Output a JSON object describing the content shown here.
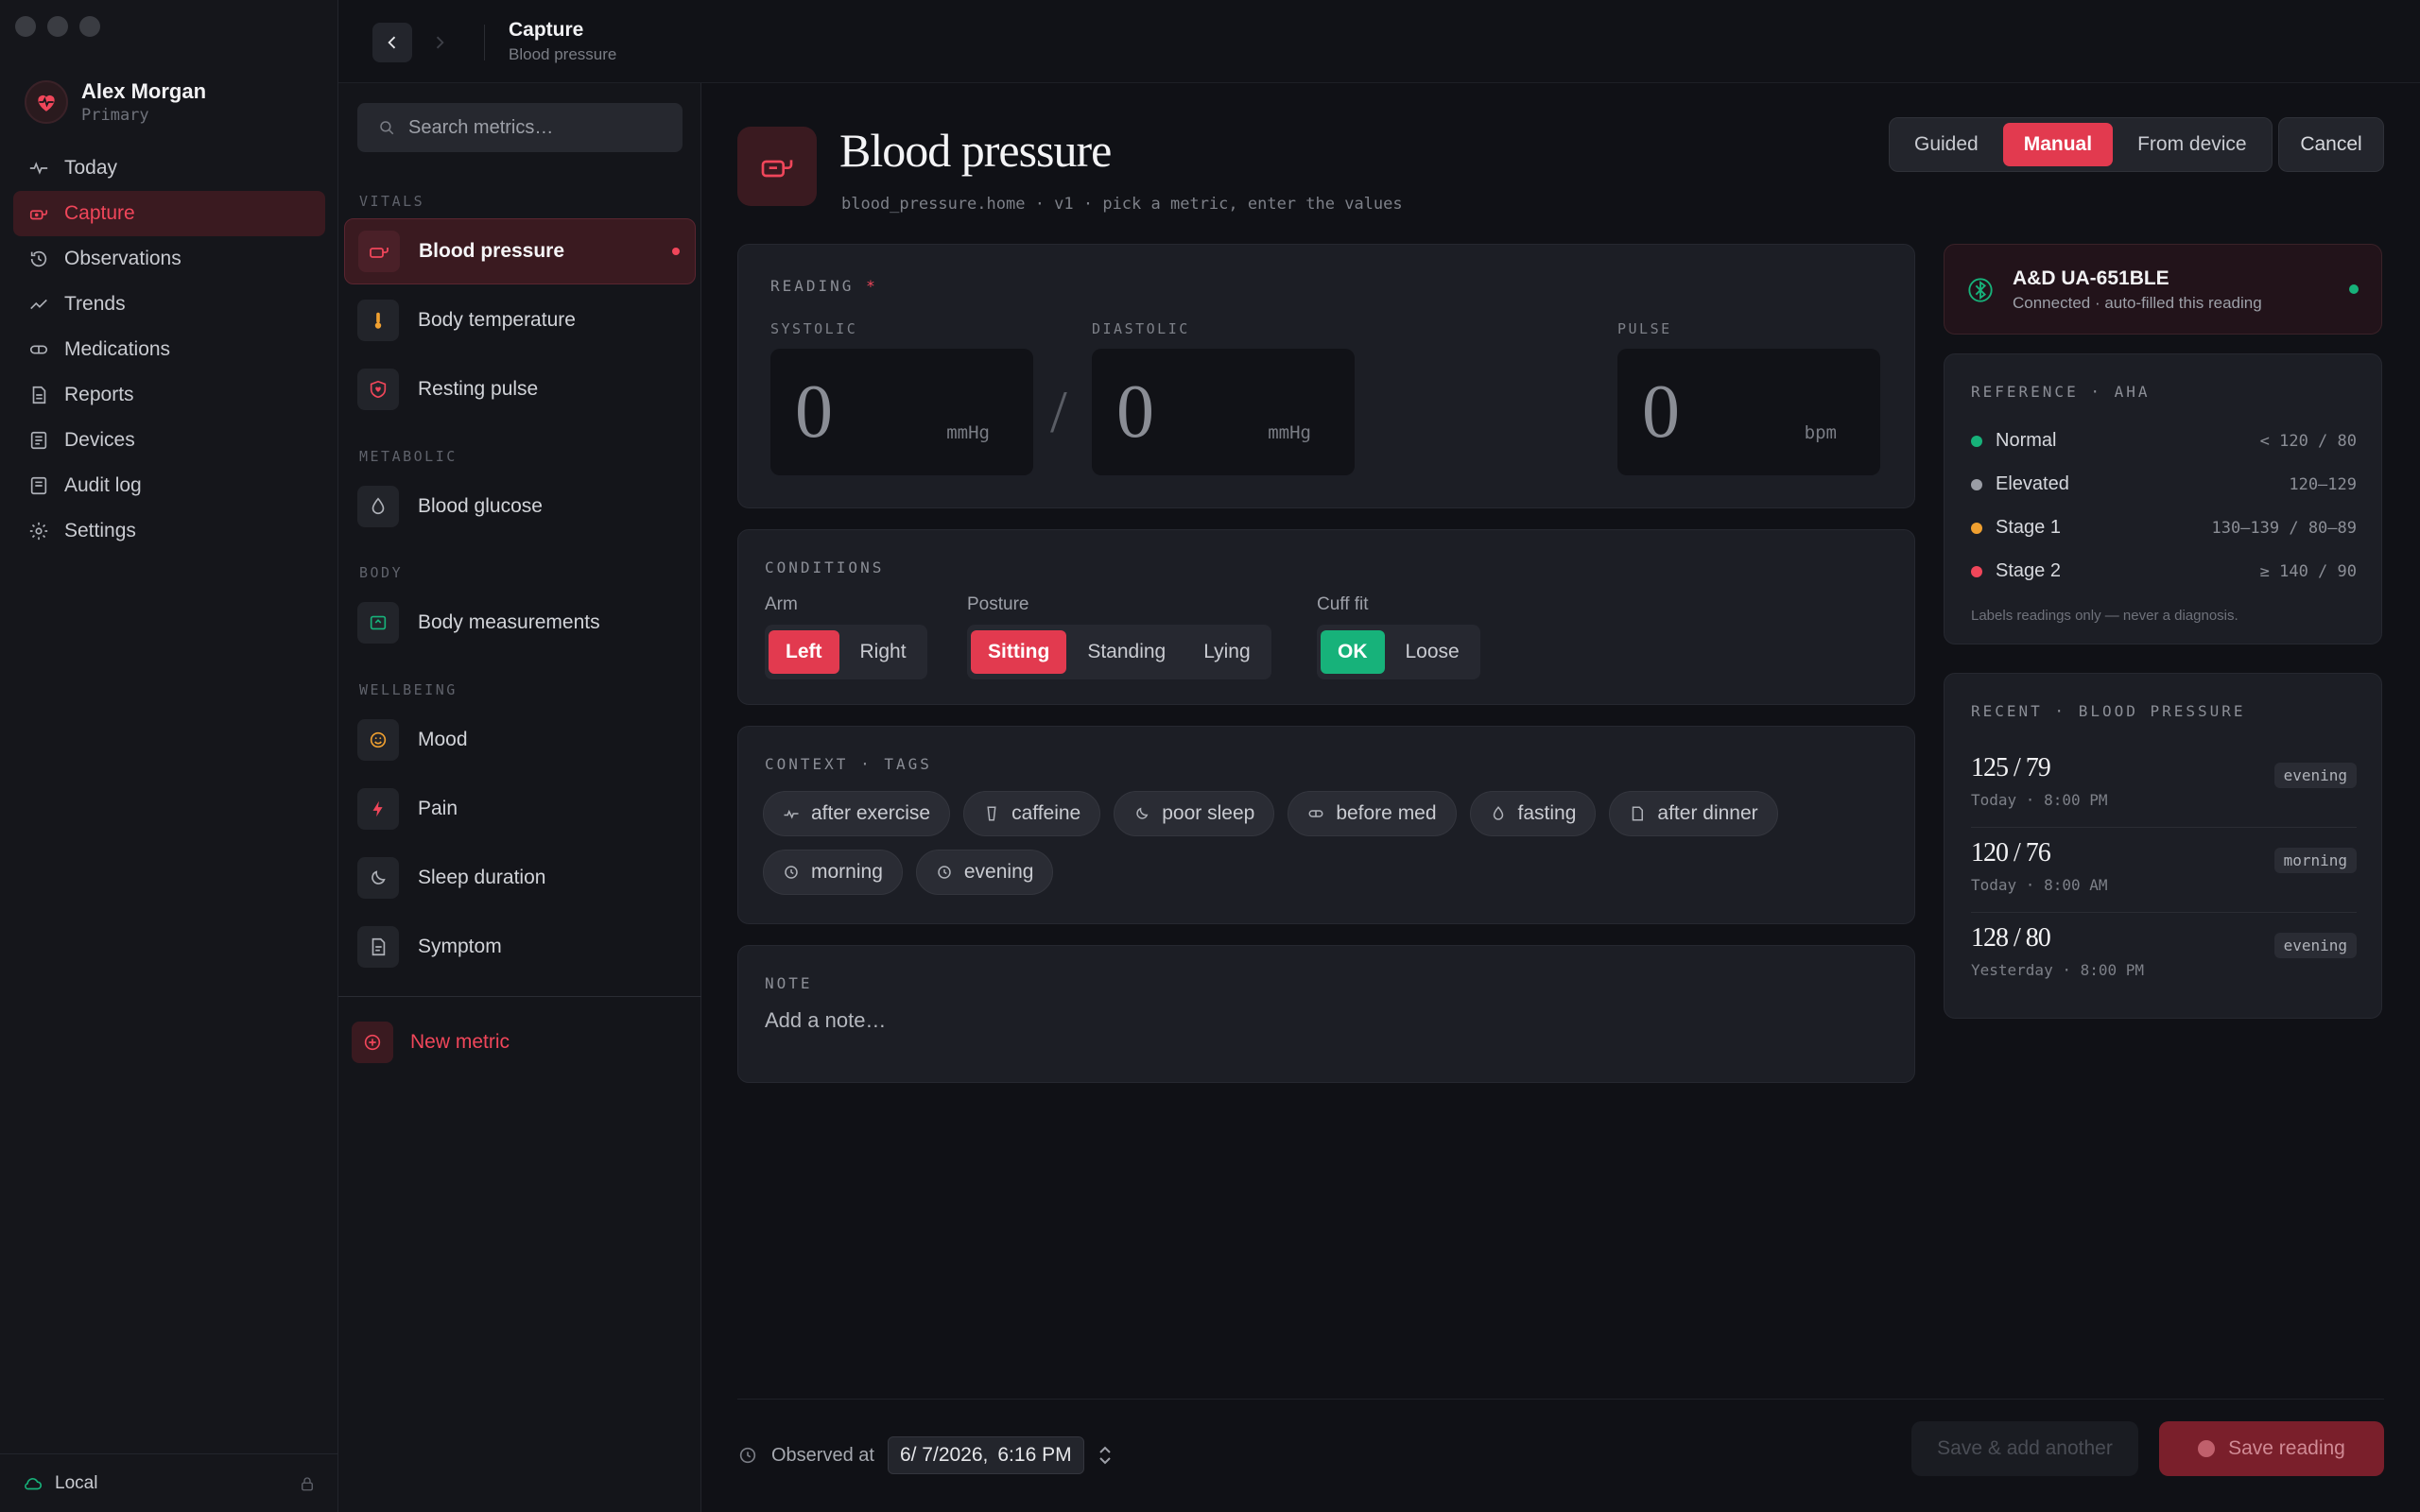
{
  "app": {
    "user_name": "Alex Morgan",
    "user_role": "Primary"
  },
  "sidebar": {
    "items": [
      {
        "label": "Today",
        "icon": "pulse-icon"
      },
      {
        "label": "Capture",
        "icon": "capture-icon"
      },
      {
        "label": "Observations",
        "icon": "history-icon"
      },
      {
        "label": "Trends",
        "icon": "trend-icon"
      },
      {
        "label": "Medications",
        "icon": "pill-icon"
      },
      {
        "label": "Reports",
        "icon": "report-icon"
      },
      {
        "label": "Devices",
        "icon": "device-icon"
      },
      {
        "label": "Audit log",
        "icon": "log-icon"
      },
      {
        "label": "Settings",
        "icon": "gear-icon"
      }
    ],
    "footer_label": "Local"
  },
  "topbar": {
    "title": "Capture",
    "subtitle": "Blood pressure"
  },
  "metrics": {
    "search_placeholder": "Search metrics…",
    "groups": {
      "vitals": "VITALS",
      "metabolic": "METABOLIC",
      "body": "BODY",
      "wellbeing": "WELLBEING"
    },
    "items": {
      "blood_pressure": "Blood pressure",
      "body_temperature": "Body temperature",
      "resting_pulse": "Resting pulse",
      "blood_glucose": "Blood glucose",
      "body_measurements": "Body measurements",
      "mood": "Mood",
      "pain": "Pain",
      "sleep_duration": "Sleep duration",
      "symptom": "Symptom"
    },
    "new_metric": "New metric"
  },
  "header": {
    "title": "Blood pressure",
    "subtitle": "blood_pressure.home · v1 · pick a metric, enter the values",
    "modes": [
      "Guided",
      "Manual",
      "From device"
    ],
    "active_mode": "Manual",
    "cancel": "Cancel"
  },
  "reading": {
    "label": "READING",
    "required": "*",
    "systolic_label": "SYSTOLIC",
    "diastolic_label": "DIASTOLIC",
    "pulse_label": "PULSE",
    "systolic": "0",
    "diastolic": "0",
    "pulse": "0",
    "unit_pressure": "mmHg",
    "unit_pulse": "bpm",
    "separator": "/"
  },
  "conditions": {
    "label": "CONDITIONS",
    "arm_label": "Arm",
    "arm_options": [
      "Left",
      "Right"
    ],
    "posture_label": "Posture",
    "posture_options": [
      "Sitting",
      "Standing",
      "Lying"
    ],
    "cuff_label": "Cuff fit",
    "cuff_options": [
      "OK",
      "Loose"
    ]
  },
  "context": {
    "label": "CONTEXT · TAGS",
    "tags": [
      "after exercise",
      "caffeine",
      "poor sleep",
      "before med",
      "fasting",
      "after dinner",
      "morning",
      "evening"
    ]
  },
  "note": {
    "label": "NOTE",
    "placeholder": "Add a note…"
  },
  "device": {
    "name": "A&D UA-651BLE",
    "status": "Connected · auto-filled this reading"
  },
  "reference": {
    "label": "REFERENCE · AHA",
    "rows": [
      {
        "name": "Normal",
        "range": "< 120 / 80",
        "color": "#17b27a"
      },
      {
        "name": "Elevated",
        "range": "120–129",
        "color": "#9a9da5"
      },
      {
        "name": "Stage 1",
        "range": "130–139 / 80–89",
        "color": "#f0a030"
      },
      {
        "name": "Stage 2",
        "range": "≥ 140 / 90",
        "color": "#f0465a"
      }
    ],
    "disclaimer": "Labels readings only — never a diagnosis."
  },
  "recent": {
    "label": "RECENT · BLOOD PRESSURE",
    "items": [
      {
        "value": "125 / 79",
        "when": "Today · 8:00 PM",
        "tag": "evening"
      },
      {
        "value": "120 / 76",
        "when": "Today · 8:00 AM",
        "tag": "morning"
      },
      {
        "value": "128 / 80",
        "when": "Yesterday · 8:00 PM",
        "tag": "evening"
      }
    ]
  },
  "footer": {
    "observed_label": "Observed at",
    "date": "6/ 7/2026,",
    "time": "6:16 PM",
    "save_add": "Save & add another",
    "save": "Save reading"
  },
  "colors": {
    "accent": "#e23a4f",
    "ok": "#17b27a"
  }
}
